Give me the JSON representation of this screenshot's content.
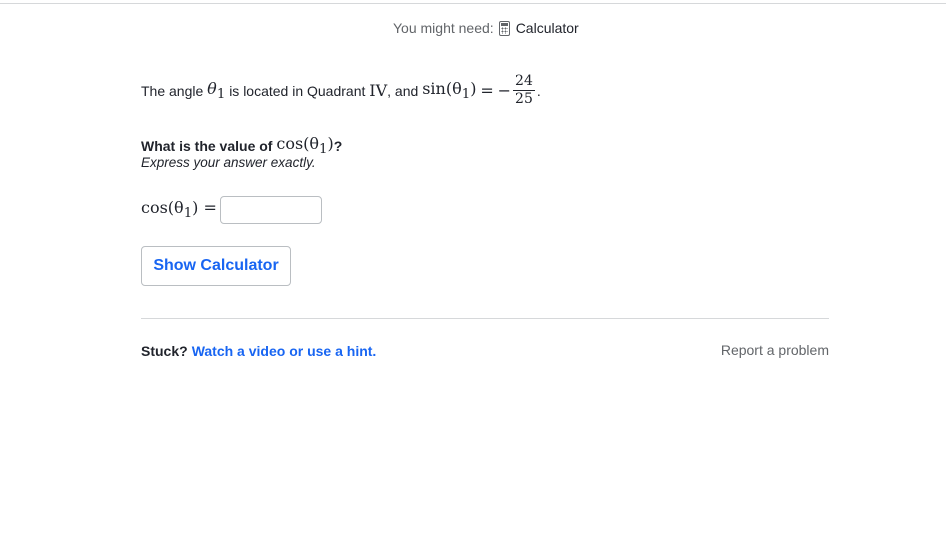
{
  "helper": {
    "prefix": "You might need:",
    "icon": "calculator-icon",
    "label": "Calculator"
  },
  "problem": {
    "text_before": "The angle",
    "theta": "θ",
    "sub": "1",
    "text_mid": "is located in Quadrant",
    "quadrant": "IV",
    "text_after": ", and",
    "sin_expr": "sin(θ",
    "sin_sub": "1",
    "sin_close": ")",
    "equals": "=",
    "minus": "−",
    "numerator": "24",
    "denominator": "25",
    "period": "."
  },
  "question": {
    "text": "What is the value of",
    "cos_expr": "cos(θ",
    "cos_sub": "1",
    "cos_close": ")",
    "qmark": "?",
    "instruction": "Express your answer exactly."
  },
  "answer": {
    "cos_expr": "cos(θ",
    "cos_sub": "1",
    "cos_close": ")",
    "equals": "=",
    "value": "",
    "placeholder": ""
  },
  "buttons": {
    "show_calculator": "Show Calculator"
  },
  "footer": {
    "stuck": "Stuck?",
    "hint_link": "Watch a video or use a hint.",
    "report": "Report a problem"
  },
  "colors": {
    "link": "#1865f2",
    "muted": "#626569",
    "text": "#21242c",
    "border": "#babec2"
  }
}
